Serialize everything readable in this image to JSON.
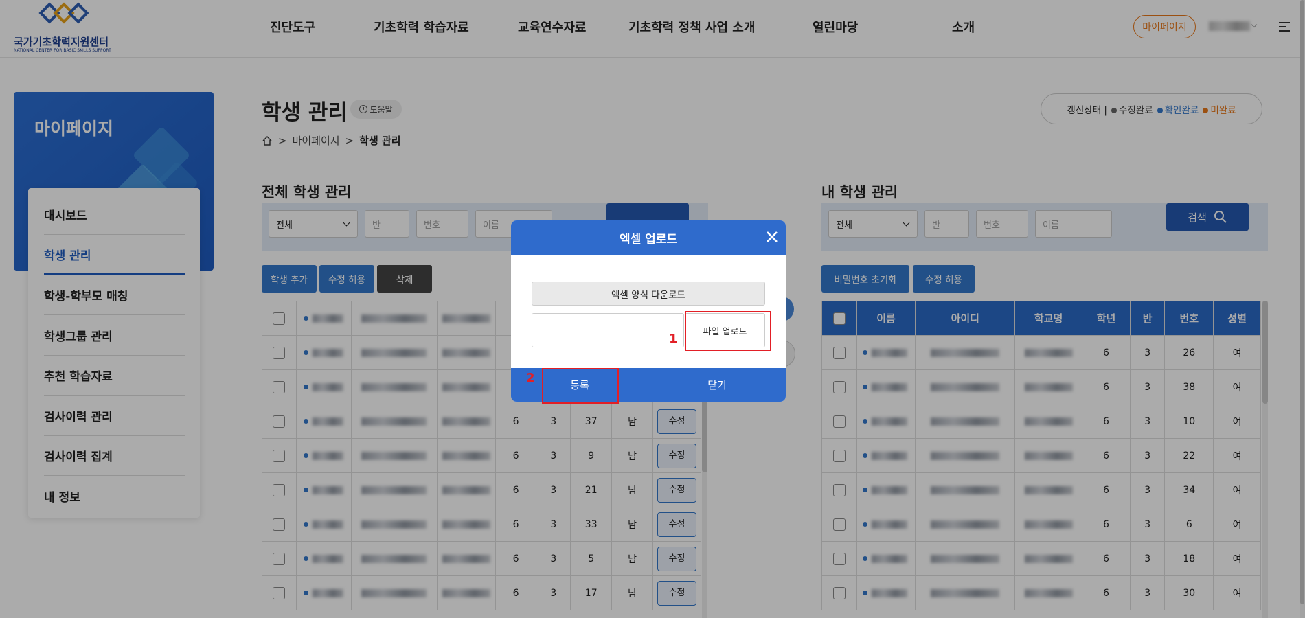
{
  "header": {
    "logo_text": "국가기초학력지원센터",
    "logo_subtext": "NATIONAL CENTER FOR BASIC SKILLS SUPPORT",
    "nav": [
      "진단도구",
      "기초학력 학습자료",
      "교육연수자료",
      "기초학력 정책 사업 소개",
      "열린마당",
      "소개"
    ],
    "mypage_label": "마이페이지"
  },
  "sidebar": {
    "title": "마이페이지",
    "items": [
      {
        "label": "대시보드",
        "active": false
      },
      {
        "label": "학생 관리",
        "active": true
      },
      {
        "label": "학생-학부모 매칭",
        "active": false
      },
      {
        "label": "학생그룹 관리",
        "active": false
      },
      {
        "label": "추천 학습자료",
        "active": false
      },
      {
        "label": "검사이력 관리",
        "active": false
      },
      {
        "label": "검사이력 집계",
        "active": false
      },
      {
        "label": "내 정보",
        "active": false
      }
    ]
  },
  "page": {
    "title": "학생 관리",
    "help_label": "도움말",
    "breadcrumb": {
      "sep": ">",
      "parent": "마이페이지",
      "current": "학생 관리"
    },
    "status": {
      "label": "갱신상태 |",
      "items": [
        {
          "label": "수정완료",
          "color": "#666666"
        },
        {
          "label": "확인완료",
          "color": "#3378cb"
        },
        {
          "label": "미완료",
          "color": "#e8781a"
        }
      ]
    }
  },
  "all_students": {
    "title": "전체 학생 관리",
    "filter": {
      "select": "전체",
      "class_ph": "반",
      "number_ph": "번호",
      "name_ph": "이름"
    },
    "buttons": {
      "add": "학생 추가",
      "allow_edit": "수정 허용",
      "delete": "삭제"
    },
    "rows": [
      {
        "grade": "6",
        "class": "3",
        "number": "37",
        "gender": "남",
        "edit": "수정"
      },
      {
        "grade": "6",
        "class": "3",
        "number": "9",
        "gender": "남",
        "edit": "수정"
      },
      {
        "grade": "6",
        "class": "3",
        "number": "21",
        "gender": "남",
        "edit": "수정"
      },
      {
        "grade": "6",
        "class": "3",
        "number": "33",
        "gender": "남",
        "edit": "수정"
      },
      {
        "grade": "6",
        "class": "3",
        "number": "5",
        "gender": "남",
        "edit": "수정"
      },
      {
        "grade": "6",
        "class": "3",
        "number": "17",
        "gender": "남",
        "edit": "수정"
      }
    ]
  },
  "my_students": {
    "title": "내 학생 관리",
    "filter": {
      "select": "전체",
      "class_ph": "반",
      "number_ph": "번호",
      "name_ph": "이름",
      "search_label": "검색"
    },
    "buttons": {
      "reset_pw": "비밀번호 초기화",
      "allow_edit": "수정 허용"
    },
    "columns": [
      "이름",
      "아이디",
      "학교명",
      "학년",
      "반",
      "번호",
      "성별"
    ],
    "rows": [
      {
        "grade": "6",
        "class": "3",
        "number": "26",
        "gender": "여"
      },
      {
        "grade": "6",
        "class": "3",
        "number": "38",
        "gender": "여"
      },
      {
        "grade": "6",
        "class": "3",
        "number": "10",
        "gender": "여"
      },
      {
        "grade": "6",
        "class": "3",
        "number": "22",
        "gender": "여"
      },
      {
        "grade": "6",
        "class": "3",
        "number": "34",
        "gender": "여"
      },
      {
        "grade": "6",
        "class": "3",
        "number": "6",
        "gender": "여"
      },
      {
        "grade": "6",
        "class": "3",
        "number": "18",
        "gender": "여"
      },
      {
        "grade": "6",
        "class": "3",
        "number": "30",
        "gender": "여"
      }
    ]
  },
  "modal": {
    "title": "엑셀 업로드",
    "download_label": "엑셀 양식 다운로드",
    "upload_label": "파일 업로드",
    "register_label": "등록",
    "close_label": "닫기",
    "annotation_1": "1",
    "annotation_2": "2"
  }
}
